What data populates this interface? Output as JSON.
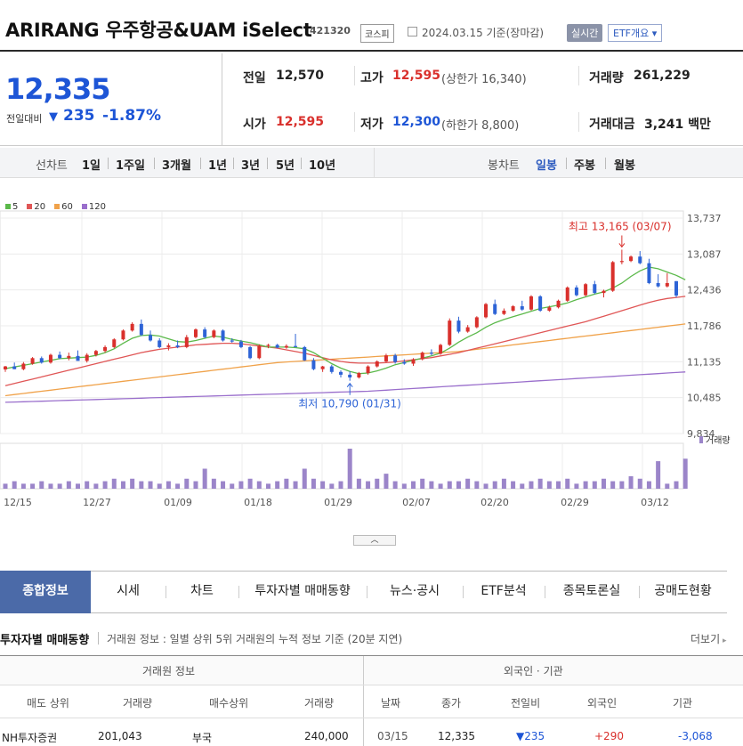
{
  "header": {
    "title": "ARIRANG 우주항공&UAM iSelect",
    "code": "421320",
    "market": "코스피",
    "asof": "2024.03.15 기준(장마감)",
    "realtime_label": "실시간",
    "etf_overview_label": "ETF개요"
  },
  "quote": {
    "price": "12,335",
    "change_label": "전일대비",
    "change_arrow": "▼",
    "change": "235",
    "change_pct": "-1.87%",
    "prev_close_label": "전일",
    "prev_close": "12,570",
    "open_label": "시가",
    "open": "12,595",
    "high_label": "고가",
    "high": "12,595",
    "upper_limit": "(상한가 16,340)",
    "low_label": "저가",
    "low": "12,300",
    "lower_limit": "(하한가 8,800)",
    "volume_label": "거래량",
    "volume": "261,229",
    "value_label": "거래대금",
    "value": "3,241",
    "value_unit": "백만"
  },
  "controls": {
    "line_label": "선차트",
    "periods": [
      "1일",
      "1주일",
      "3개월",
      "1년",
      "3년",
      "5년",
      "10년"
    ],
    "candle_label": "봉차트",
    "candle_periods": [
      "일봉",
      "주봉",
      "월봉"
    ],
    "selected_candle": "일봉"
  },
  "chart_data": {
    "type": "candlestick",
    "ma_legend": [
      {
        "name": "5",
        "color": "#5bb94a"
      },
      {
        "name": "20",
        "color": "#e05656"
      },
      {
        "name": "60",
        "color": "#f0a24a"
      },
      {
        "name": "120",
        "color": "#9a6fcc"
      }
    ],
    "y_ticks": [
      "13,737",
      "13,087",
      "12,436",
      "11,786",
      "11,135",
      "10,485",
      "9,834"
    ],
    "ylim": [
      9834,
      13737
    ],
    "x_ticks": [
      "12/15",
      "12/27",
      "01/09",
      "01/18",
      "01/29",
      "02/07",
      "02/20",
      "02/29",
      "03/12"
    ],
    "high_annotation": "최고 13,165 (03/07)",
    "low_annotation": "최저 10,790 (01/31)",
    "volume_label": "거래량",
    "candles": [
      {
        "o": 10995,
        "h": 11060,
        "l": 10950,
        "c": 11050
      },
      {
        "o": 11050,
        "h": 11120,
        "l": 11000,
        "c": 11000
      },
      {
        "o": 11000,
        "h": 11130,
        "l": 10980,
        "c": 11100
      },
      {
        "o": 11100,
        "h": 11220,
        "l": 11080,
        "c": 11200
      },
      {
        "o": 11200,
        "h": 11230,
        "l": 11100,
        "c": 11120
      },
      {
        "o": 11120,
        "h": 11280,
        "l": 11100,
        "c": 11260
      },
      {
        "o": 11260,
        "h": 11320,
        "l": 11180,
        "c": 11200
      },
      {
        "o": 11200,
        "h": 11300,
        "l": 11160,
        "c": 11240
      },
      {
        "o": 11240,
        "h": 11340,
        "l": 11200,
        "c": 11150
      },
      {
        "o": 11150,
        "h": 11290,
        "l": 11120,
        "c": 11260
      },
      {
        "o": 11260,
        "h": 11350,
        "l": 11230,
        "c": 11330
      },
      {
        "o": 11330,
        "h": 11430,
        "l": 11300,
        "c": 11400
      },
      {
        "o": 11400,
        "h": 11560,
        "l": 11380,
        "c": 11540
      },
      {
        "o": 11540,
        "h": 11720,
        "l": 11520,
        "c": 11700
      },
      {
        "o": 11700,
        "h": 11850,
        "l": 11680,
        "c": 11820
      },
      {
        "o": 11820,
        "h": 11900,
        "l": 11600,
        "c": 11620
      },
      {
        "o": 11620,
        "h": 11700,
        "l": 11500,
        "c": 11520
      },
      {
        "o": 11520,
        "h": 11560,
        "l": 11380,
        "c": 11400
      },
      {
        "o": 11400,
        "h": 11470,
        "l": 11340,
        "c": 11430
      },
      {
        "o": 11430,
        "h": 11520,
        "l": 11380,
        "c": 11400
      },
      {
        "o": 11400,
        "h": 11620,
        "l": 11380,
        "c": 11580
      },
      {
        "o": 11580,
        "h": 11740,
        "l": 11560,
        "c": 11720
      },
      {
        "o": 11720,
        "h": 11760,
        "l": 11560,
        "c": 11580
      },
      {
        "o": 11580,
        "h": 11720,
        "l": 11560,
        "c": 11700
      },
      {
        "o": 11700,
        "h": 11720,
        "l": 11500,
        "c": 11520
      },
      {
        "o": 11520,
        "h": 11560,
        "l": 11480,
        "c": 11500
      },
      {
        "o": 11500,
        "h": 11530,
        "l": 11380,
        "c": 11400
      },
      {
        "o": 11400,
        "h": 11420,
        "l": 11180,
        "c": 11200
      },
      {
        "o": 11200,
        "h": 11450,
        "l": 11180,
        "c": 11420
      },
      {
        "o": 11420,
        "h": 11460,
        "l": 11380,
        "c": 11440
      },
      {
        "o": 11440,
        "h": 11460,
        "l": 11380,
        "c": 11390
      },
      {
        "o": 11390,
        "h": 11450,
        "l": 11370,
        "c": 11420
      },
      {
        "o": 11420,
        "h": 11640,
        "l": 11400,
        "c": 11400
      },
      {
        "o": 11400,
        "h": 11420,
        "l": 11150,
        "c": 11160
      },
      {
        "o": 11160,
        "h": 11200,
        "l": 10980,
        "c": 11000
      },
      {
        "o": 11000,
        "h": 11060,
        "l": 10950,
        "c": 11050
      },
      {
        "o": 11050,
        "h": 11080,
        "l": 10920,
        "c": 10950
      },
      {
        "o": 10950,
        "h": 10980,
        "l": 10850,
        "c": 10900
      },
      {
        "o": 10900,
        "h": 10960,
        "l": 10790,
        "c": 10850
      },
      {
        "o": 10850,
        "h": 10950,
        "l": 10830,
        "c": 10930
      },
      {
        "o": 10930,
        "h": 11070,
        "l": 10900,
        "c": 11050
      },
      {
        "o": 11050,
        "h": 11160,
        "l": 11030,
        "c": 11140
      },
      {
        "o": 11140,
        "h": 11280,
        "l": 11120,
        "c": 11250
      },
      {
        "o": 11250,
        "h": 11280,
        "l": 11100,
        "c": 11130
      },
      {
        "o": 11130,
        "h": 11180,
        "l": 11080,
        "c": 11100
      },
      {
        "o": 11100,
        "h": 11200,
        "l": 11060,
        "c": 11180
      },
      {
        "o": 11180,
        "h": 11320,
        "l": 11160,
        "c": 11300
      },
      {
        "o": 11300,
        "h": 11360,
        "l": 11250,
        "c": 11280
      },
      {
        "o": 11280,
        "h": 11460,
        "l": 11260,
        "c": 11440
      },
      {
        "o": 11440,
        "h": 11920,
        "l": 11420,
        "c": 11880
      },
      {
        "o": 11880,
        "h": 11950,
        "l": 11650,
        "c": 11680
      },
      {
        "o": 11680,
        "h": 11800,
        "l": 11660,
        "c": 11760
      },
      {
        "o": 11760,
        "h": 11960,
        "l": 11740,
        "c": 11940
      },
      {
        "o": 11940,
        "h": 12200,
        "l": 11920,
        "c": 12180
      },
      {
        "o": 12180,
        "h": 12260,
        "l": 11980,
        "c": 12000
      },
      {
        "o": 12000,
        "h": 12100,
        "l": 11980,
        "c": 12060
      },
      {
        "o": 12060,
        "h": 12160,
        "l": 12040,
        "c": 12140
      },
      {
        "o": 12140,
        "h": 12240,
        "l": 12060,
        "c": 12080
      },
      {
        "o": 12080,
        "h": 12340,
        "l": 12060,
        "c": 12320
      },
      {
        "o": 12320,
        "h": 12340,
        "l": 12040,
        "c": 12060
      },
      {
        "o": 12060,
        "h": 12150,
        "l": 12040,
        "c": 12120
      },
      {
        "o": 12120,
        "h": 12260,
        "l": 12100,
        "c": 12240
      },
      {
        "o": 12240,
        "h": 12500,
        "l": 12220,
        "c": 12480
      },
      {
        "o": 12480,
        "h": 12520,
        "l": 12320,
        "c": 12340
      },
      {
        "o": 12340,
        "h": 12560,
        "l": 12320,
        "c": 12540
      },
      {
        "o": 12540,
        "h": 12600,
        "l": 12360,
        "c": 12380
      },
      {
        "o": 12380,
        "h": 12440,
        "l": 12300,
        "c": 12420
      },
      {
        "o": 12420,
        "h": 12960,
        "l": 12400,
        "c": 12940
      },
      {
        "o": 12940,
        "h": 13165,
        "l": 12900,
        "c": 12960
      },
      {
        "o": 12960,
        "h": 13060,
        "l": 12940,
        "c": 13040
      },
      {
        "o": 13040,
        "h": 13140,
        "l": 12900,
        "c": 12920
      },
      {
        "o": 12920,
        "h": 13000,
        "l": 12540,
        "c": 12560
      },
      {
        "o": 12560,
        "h": 12720,
        "l": 12480,
        "c": 12500
      },
      {
        "o": 12500,
        "h": 12740,
        "l": 12480,
        "c": 12560
      },
      {
        "o": 12595,
        "h": 12595,
        "l": 12300,
        "c": 12335
      }
    ],
    "ma5": [
      11010,
      11040,
      11070,
      11100,
      11130,
      11160,
      11190,
      11200,
      11210,
      11220,
      11250,
      11300,
      11370,
      11470,
      11560,
      11610,
      11620,
      11600,
      11550,
      11500,
      11490,
      11520,
      11560,
      11600,
      11580,
      11540,
      11510,
      11480,
      11440,
      11400,
      11400,
      11400,
      11390,
      11370,
      11300,
      11200,
      11100,
      11020,
      10960,
      10920,
      10930,
      10970,
      11020,
      11080,
      11120,
      11160,
      11200,
      11240,
      11290,
      11380,
      11490,
      11580,
      11660,
      11760,
      11840,
      11900,
      11950,
      12000,
      12050,
      12100,
      12130,
      12160,
      12200,
      12260,
      12310,
      12360,
      12400,
      12470,
      12560,
      12680,
      12780,
      12850,
      12820,
      12760,
      12700,
      12620
    ],
    "ma20": [
      10700,
      10740,
      10780,
      10820,
      10860,
      10900,
      10940,
      10980,
      11020,
      11060,
      11100,
      11140,
      11180,
      11220,
      11260,
      11300,
      11330,
      11360,
      11380,
      11400,
      11420,
      11440,
      11450,
      11460,
      11470,
      11470,
      11460,
      11440,
      11420,
      11400,
      11380,
      11350,
      11320,
      11290,
      11250,
      11210,
      11170,
      11140,
      11120,
      11110,
      11110,
      11110,
      11120,
      11130,
      11150,
      11170,
      11190,
      11210,
      11240,
      11270,
      11300,
      11340,
      11380,
      11420,
      11460,
      11500,
      11540,
      11580,
      11620,
      11660,
      11700,
      11740,
      11780,
      11820,
      11860,
      11910,
      11960,
      12010,
      12060,
      12110,
      12160,
      12210,
      12250,
      12280,
      12300,
      12320
    ],
    "ma60": [
      10520,
      10540,
      10560,
      10580,
      10600,
      10620,
      10640,
      10660,
      10680,
      10700,
      10720,
      10740,
      10760,
      10780,
      10800,
      10820,
      10840,
      10860,
      10880,
      10900,
      10920,
      10940,
      10960,
      10980,
      11000,
      11020,
      11040,
      11060,
      11080,
      11100,
      11120,
      11130,
      11140,
      11150,
      11160,
      11170,
      11180,
      11190,
      11200,
      11210,
      11220,
      11230,
      11240,
      11250,
      11260,
      11270,
      11280,
      11290,
      11300,
      11310,
      11320,
      11340,
      11360,
      11380,
      11400,
      11420,
      11440,
      11460,
      11480,
      11500,
      11520,
      11540,
      11560,
      11580,
      11600,
      11620,
      11640,
      11660,
      11680,
      11700,
      11720,
      11740,
      11760,
      11780,
      11800,
      11820
    ],
    "ma120": [
      10400,
      10405,
      10410,
      10415,
      10420,
      10425,
      10430,
      10435,
      10440,
      10445,
      10450,
      10455,
      10460,
      10465,
      10470,
      10475,
      10480,
      10485,
      10490,
      10495,
      10500,
      10505,
      10510,
      10515,
      10520,
      10525,
      10530,
      10535,
      10540,
      10545,
      10550,
      10555,
      10560,
      10565,
      10570,
      10575,
      10580,
      10585,
      10590,
      10595,
      10600,
      10610,
      10620,
      10630,
      10640,
      10650,
      10660,
      10670,
      10680,
      10690,
      10700,
      10710,
      10720,
      10730,
      10740,
      10750,
      10760,
      10770,
      10780,
      10790,
      10800,
      10810,
      10820,
      10830,
      10840,
      10850,
      10860,
      10870,
      10880,
      10890,
      10900,
      10910,
      10920,
      10930,
      10940,
      10950
    ],
    "volume": [
      2,
      3,
      2,
      2,
      3,
      2,
      2,
      3,
      2,
      3,
      2,
      3,
      4,
      3,
      4,
      3,
      3,
      2,
      3,
      2,
      4,
      3,
      8,
      4,
      3,
      2,
      3,
      4,
      3,
      2,
      3,
      4,
      3,
      8,
      4,
      3,
      2,
      3,
      16,
      4,
      3,
      4,
      6,
      3,
      2,
      3,
      4,
      3,
      2,
      3,
      3,
      4,
      3,
      2,
      3,
      4,
      3,
      2,
      3,
      4,
      3,
      3,
      4,
      2,
      3,
      3,
      4,
      3,
      3,
      5,
      4,
      3,
      11,
      2,
      3,
      12
    ]
  },
  "tabs": [
    "종합정보",
    "시세",
    "차트",
    "투자자별 매매동향",
    "뉴스·공시",
    "ETF분석",
    "종목토론실",
    "공매도현황"
  ],
  "section": {
    "title": "투자자별 매매동향",
    "desc": "거래원 정보 : 일별 상위 5위 거래원의 누적 정보 기준 (20분 지연)",
    "more": "더보기"
  },
  "broker_table": {
    "group_left": "거래원 정보",
    "group_right": "외국인 · 기관",
    "headers": [
      "매도 상위",
      "거래량",
      "매수상위",
      "거래량",
      "날짜",
      "종가",
      "전일비",
      "외국인",
      "기관"
    ],
    "row": {
      "sell_top": "NH투자증권",
      "sell_vol": "201,043",
      "buy_top": "부국",
      "buy_vol": "240,000",
      "date": "03/15",
      "close": "12,335",
      "change": "▼235",
      "foreign": "+290",
      "inst": "-3,068"
    }
  }
}
